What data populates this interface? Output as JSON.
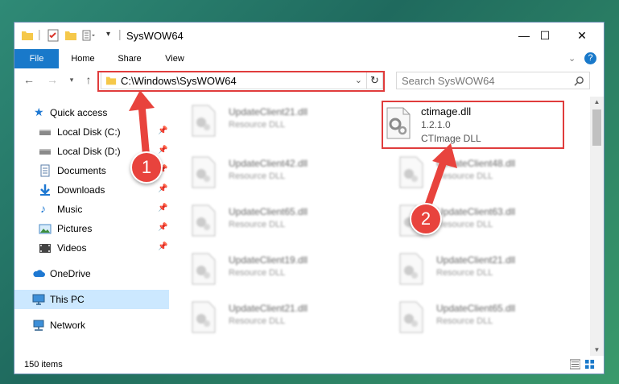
{
  "window": {
    "title": "SysWOW64",
    "controls": {
      "minimize": "—",
      "maximize": "☐",
      "close": "✕"
    }
  },
  "ribbon": {
    "tabs": [
      "File",
      "Home",
      "Share",
      "View"
    ],
    "help": "?"
  },
  "address": {
    "path": "C:\\Windows\\SysWOW64",
    "search_placeholder": "Search SysWOW64"
  },
  "nav": {
    "items": [
      {
        "label": "Quick access",
        "icon": "star-icon"
      },
      {
        "label": "Local Disk (C:)",
        "icon": "drive-icon",
        "pinned": true
      },
      {
        "label": "Local Disk (D:)",
        "icon": "drive-icon",
        "pinned": true
      },
      {
        "label": "Documents",
        "icon": "documents-icon",
        "pinned": true
      },
      {
        "label": "Downloads",
        "icon": "downloads-icon",
        "pinned": true
      },
      {
        "label": "Music",
        "icon": "music-icon",
        "pinned": true
      },
      {
        "label": "Pictures",
        "icon": "pictures-icon",
        "pinned": true
      },
      {
        "label": "Videos",
        "icon": "videos-icon",
        "pinned": true
      },
      {
        "label": "OneDrive",
        "icon": "cloud-icon"
      },
      {
        "label": "This PC",
        "icon": "computer-icon",
        "selected": true
      },
      {
        "label": "Network",
        "icon": "network-icon"
      }
    ]
  },
  "files": {
    "left_column": [
      {
        "name": "UpdateClient21.dll",
        "type": "Resource DLL"
      },
      {
        "name": "UpdateClient42.dll",
        "type": "Resource DLL"
      },
      {
        "name": "UpdateClient65.dll",
        "type": "Resource DLL"
      },
      {
        "name": "UpdateClient19.dll",
        "type": "Resource DLL"
      },
      {
        "name": "UpdateClient21.dll",
        "type": "Resource DLL"
      }
    ],
    "right_column": [
      {
        "name": "UpdateClient48.dll",
        "type": "Resource DLL"
      },
      {
        "name": "UpdateClient63.dll",
        "type": "Resource DLL"
      },
      {
        "name": "UpdateClient21.dll",
        "type": "Resource DLL"
      },
      {
        "name": "UpdateClient65.dll",
        "type": "Resource DLL"
      }
    ],
    "highlighted": {
      "name": "ctimage.dll",
      "version": "1.2.1.0",
      "type": "CTImage DLL"
    }
  },
  "status": {
    "item_count": "150 items"
  },
  "annotations": {
    "step1": "1",
    "step2": "2",
    "color": "#e03c3c"
  }
}
